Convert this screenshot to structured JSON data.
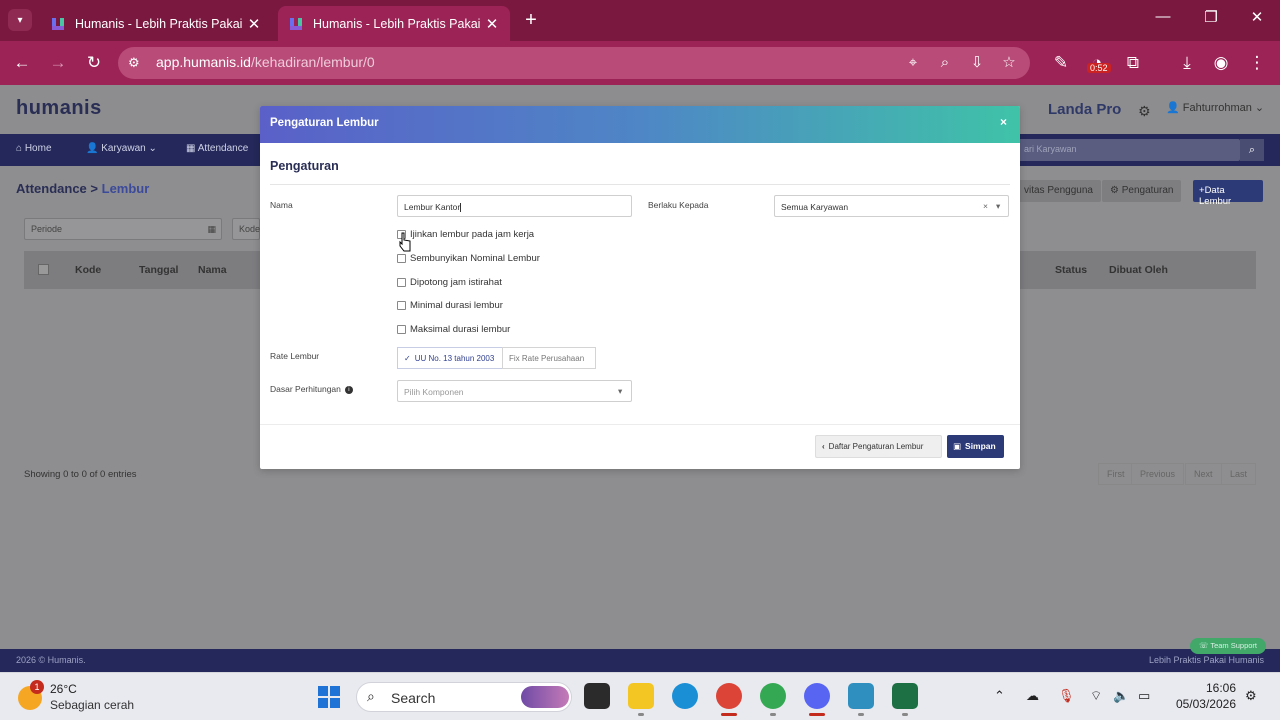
{
  "browser": {
    "tabs": [
      {
        "title": "Humanis - Lebih Praktis Pakai H",
        "active": false
      },
      {
        "title": "Humanis - Lebih Praktis Pakai H",
        "active": true
      }
    ],
    "url_domain": "app.humanis.id",
    "url_path": "/kehadiran/lembur/0",
    "extension_badge": "0:52"
  },
  "app": {
    "logo": "humanis",
    "plan": "Landa Pro",
    "user": "Fahturrohman",
    "nav": [
      {
        "label": "Home",
        "icon": "home-icon"
      },
      {
        "label": "Karyawan",
        "icon": "user-icon"
      },
      {
        "label": "Attendance",
        "icon": "calendar-icon"
      }
    ],
    "nav_search_placeholder": "ari Karyawan",
    "breadcrumb": {
      "parent": "Attendance",
      "sep": ">",
      "current": "Lembur"
    },
    "buttons": {
      "activity": "vitas Pengguna",
      "settings": "Pengaturan",
      "add": "Data Lembur"
    },
    "filters": {
      "periode": "Periode",
      "kode": "Kode"
    },
    "table": {
      "headers": [
        "Kode",
        "Tanggal",
        "Nama",
        "Status",
        "Dibuat Oleh"
      ]
    },
    "entries_info": "Showing 0 to 0 of 0 entries",
    "pager": [
      "First",
      "Previous",
      "Next",
      "Last"
    ],
    "footer_left": "2026 © Humanis.",
    "footer_right": "Lebih Praktis Pakai Humanis",
    "team_support": "Team Support"
  },
  "modal": {
    "title": "Pengaturan Lembur",
    "close": "×",
    "section": "Pengaturan",
    "nama_label": "Nama",
    "nama_value": "Lembur Kantor",
    "berlaku_label": "Berlaku Kepada",
    "berlaku_value": "Semua Karyawan",
    "checkboxes": [
      "Ijinkan lembur pada jam kerja",
      "Sembunyikan Nominal Lembur",
      "Dipotong jam istirahat",
      "Minimal durasi lembur",
      "Maksimal durasi lembur"
    ],
    "rate_label": "Rate Lembur",
    "rate_options": [
      "UU No. 13 tahun 2003",
      "Fix Rate Perusahaan"
    ],
    "dasar_label": "Dasar Perhitungan",
    "dasar_placeholder": "Pilih Komponen",
    "back_button": "Daftar Pengaturan Lembur",
    "save_button": "Simpan"
  },
  "taskbar": {
    "weather_temp": "26°C",
    "weather_desc": "Sebagian cerah",
    "weather_badge": "1",
    "search_placeholder": "Search",
    "time": "16:06",
    "date": "05/03/2026"
  }
}
